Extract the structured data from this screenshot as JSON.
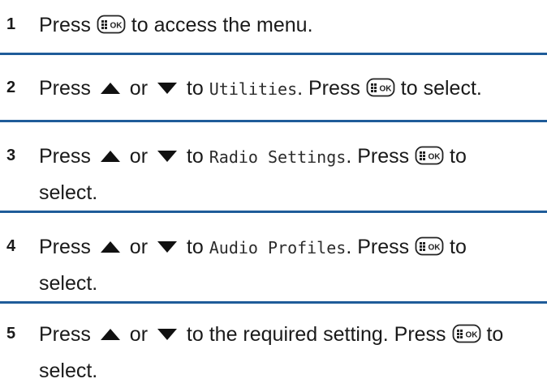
{
  "steps": [
    {
      "number": "1",
      "lines": [
        [
          "Press ",
          "{ok}",
          " to access the menu."
        ]
      ]
    },
    {
      "number": "2",
      "lines": [
        [
          "Press ",
          "{up}",
          " or ",
          "{down}",
          " to ",
          "{mono:Utilities}",
          ". Press ",
          "{ok}",
          " to select."
        ]
      ]
    },
    {
      "number": "3",
      "lines": [
        [
          "Press ",
          "{up}",
          " or ",
          "{down}",
          " to ",
          "{mono:Radio Settings}",
          ". Press ",
          "{ok}",
          " to"
        ],
        [
          "select."
        ]
      ]
    },
    {
      "number": "4",
      "lines": [
        [
          "Press ",
          "{up}",
          " or ",
          "{down}",
          " to ",
          "{mono:Audio Profiles}",
          ". Press ",
          "{ok}",
          " to"
        ],
        [
          "select."
        ]
      ]
    },
    {
      "number": "5",
      "lines": [
        [
          "Press ",
          "{up}",
          " or ",
          "{down}",
          " to the required setting. Press ",
          "{ok}",
          " to"
        ],
        [
          "select."
        ]
      ]
    }
  ],
  "icons": {
    "ok_key": "menu-ok-key-icon",
    "up": "up-arrow-icon",
    "down": "down-arrow-icon",
    "ok_key_label": "OK"
  },
  "colors": {
    "divider": "#1f5c99",
    "text": "#1a1a1a"
  }
}
